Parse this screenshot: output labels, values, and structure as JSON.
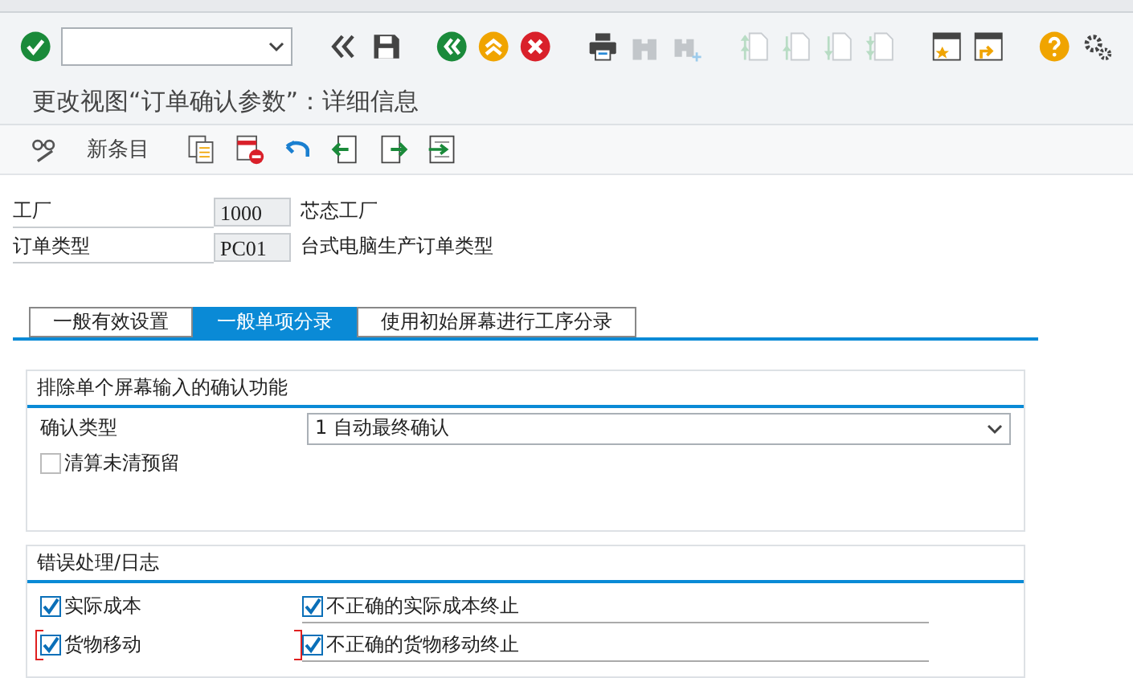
{
  "toolbar": [
    {
      "kind": "enter",
      "disabled": false
    },
    {
      "kind": "command",
      "disabled": false
    },
    {
      "kind": "collapse",
      "disabled": false
    },
    {
      "kind": "save",
      "disabled": false
    },
    {
      "kind": "back",
      "disabled": false
    },
    {
      "kind": "exit",
      "disabled": false
    },
    {
      "kind": "cancel",
      "disabled": false
    },
    {
      "kind": "print",
      "disabled": false
    },
    {
      "kind": "find",
      "disabled": true
    },
    {
      "kind": "find-next",
      "disabled": true
    },
    {
      "kind": "first-page",
      "disabled": true
    },
    {
      "kind": "previous-page",
      "disabled": true
    },
    {
      "kind": "next-page",
      "disabled": true
    },
    {
      "kind": "last-page",
      "disabled": true
    },
    {
      "kind": "new-session",
      "disabled": false
    },
    {
      "kind": "shortcut",
      "disabled": false
    },
    {
      "kind": "help",
      "disabled": false
    },
    {
      "kind": "settings",
      "disabled": false
    }
  ],
  "title": "更改视图“订单确认参数”：详细信息",
  "app_toolbar": [
    {
      "kind": "display-change"
    },
    {
      "kind": "new-entries",
      "label": "新条目"
    },
    {
      "kind": "copy"
    },
    {
      "kind": "delete"
    },
    {
      "kind": "undo"
    },
    {
      "kind": "previous"
    },
    {
      "kind": "next"
    },
    {
      "kind": "select"
    }
  ],
  "fields": [
    {
      "label": "工厂",
      "value": "1000",
      "description": "芯态工厂"
    },
    {
      "label": "订单类型",
      "value": "PC01",
      "description": "台式电脑生产订单类型"
    }
  ],
  "tabs": [
    {
      "label": "一般有效设置",
      "selected": false
    },
    {
      "label": "一般单项分录",
      "selected": true
    },
    {
      "label": "使用初始屏幕进行工序分录",
      "selected": false
    }
  ],
  "confirmation_group": {
    "title": "排除单个屏幕输入的确认功能",
    "confirmation_type": {
      "label": "确认类型",
      "value": "1 自动最终确认"
    },
    "checkbox": {
      "label": "清算未清预留",
      "checked": false
    }
  },
  "error_group": {
    "title": "错误处理/日志",
    "rows": [
      {
        "left": {
          "label": "实际成本",
          "checked": true,
          "focused": false
        },
        "right": {
          "label": "不正确的实际成本终止",
          "checked": true
        }
      },
      {
        "left": {
          "label": "货物移动",
          "checked": true,
          "focused": true
        },
        "right": {
          "label": "不正确的货物移动终止",
          "checked": true
        }
      }
    ]
  }
}
